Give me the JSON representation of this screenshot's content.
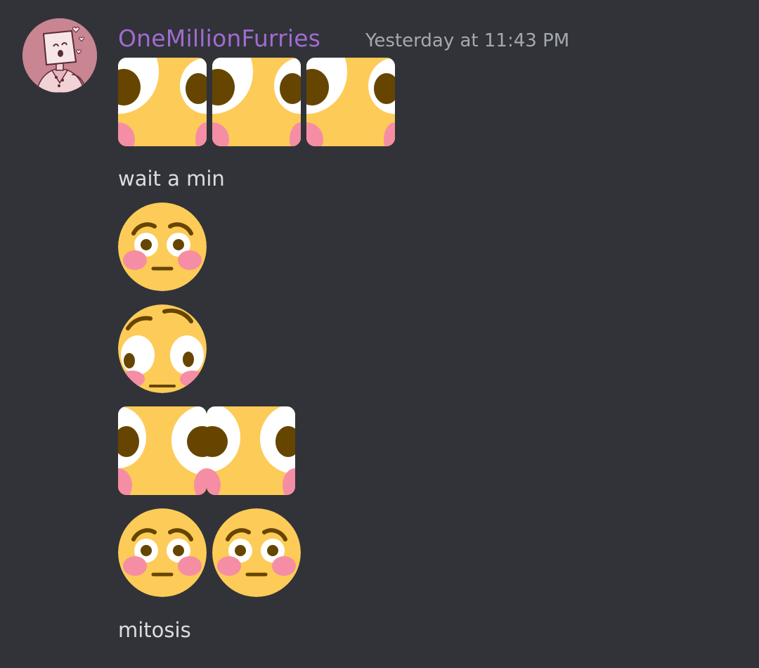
{
  "message": {
    "username": "OneMillionFurries",
    "timestamp": "Yesterday at 11:43 PM",
    "lines": [
      "wait a min",
      "mitosis"
    ]
  },
  "emoji_rows": [
    {
      "kind": "zoomed-crop",
      "count": 3
    },
    {
      "kind": "flushed-face",
      "count": 1
    },
    {
      "kind": "flushed-face-tilted",
      "count": 1
    },
    {
      "kind": "zoomed-crop",
      "count": 2
    },
    {
      "kind": "flushed-face",
      "count": 2
    }
  ],
  "colors": {
    "background": "#313338",
    "username": "#a16bd1",
    "timestamp": "#a4a8b1",
    "text": "#dbdee1",
    "emoji_yellow": "#fdcb58",
    "emoji_blush": "#f58ea4",
    "emoji_brown": "#664500"
  },
  "icons": [
    "user-avatar",
    "flushed-face-emoji"
  ]
}
